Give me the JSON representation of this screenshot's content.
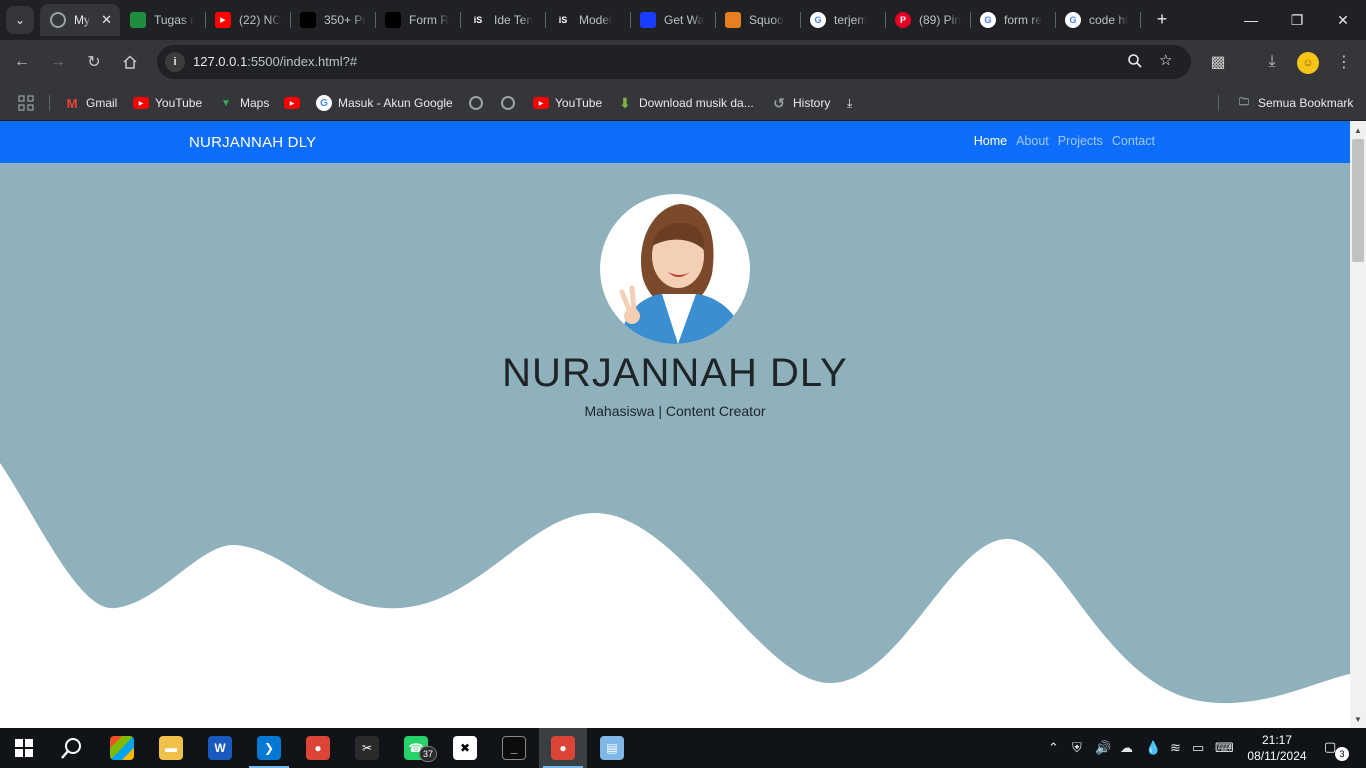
{
  "browser": {
    "tabs": [
      {
        "label": "My",
        "active": true,
        "icon": "globe-icon",
        "color": "#5f6368"
      },
      {
        "label": "Tugas r",
        "icon": "classroom-icon",
        "color": "#1e8e3e"
      },
      {
        "label": "(22) NC",
        "icon": "youtube-icon",
        "color": "#ff0000"
      },
      {
        "label": "350+ Pr",
        "icon": "site-icon",
        "color": "#000000"
      },
      {
        "label": "Form R",
        "icon": "site-icon",
        "color": "#000000"
      },
      {
        "label": "Ide Ten",
        "icon": "is-icon",
        "color": "#000000"
      },
      {
        "label": "Model",
        "icon": "is-icon",
        "color": "#000000"
      },
      {
        "label": "Get Wa",
        "icon": "getwa-icon",
        "color": "#1a3cff"
      },
      {
        "label": "Squoo",
        "icon": "squoosh-icon",
        "color": "#e67e22"
      },
      {
        "label": "terjem",
        "icon": "google-icon",
        "color": "#ffffff"
      },
      {
        "label": "(89) Pin",
        "icon": "pinterest-icon",
        "color": "#e60023"
      },
      {
        "label": "form re",
        "icon": "google-icon",
        "color": "#ffffff"
      },
      {
        "label": "code ht",
        "icon": "google-icon",
        "color": "#ffffff"
      }
    ],
    "url_host": "127.0.0.1",
    "url_rest": ":5500/index.html?#",
    "bookmarks": [
      {
        "label": "Gmail",
        "icon": "gmail-icon",
        "color": "#ea4335"
      },
      {
        "label": "YouTube",
        "icon": "youtube-icon",
        "color": "#ff0000"
      },
      {
        "label": "Maps",
        "icon": "maps-icon",
        "color": "#34a853"
      },
      {
        "label": "",
        "icon": "youtube-icon",
        "color": "#ff0000"
      },
      {
        "label": "Masuk - Akun Google",
        "icon": "google-icon",
        "color": "#ffffff"
      },
      {
        "label": "",
        "icon": "globe-icon",
        "color": "#9aa0a6"
      },
      {
        "label": "",
        "icon": "globe-icon",
        "color": "#9aa0a6"
      },
      {
        "label": "YouTube",
        "icon": "youtube-icon",
        "color": "#ff0000"
      },
      {
        "label": "Download musik da...",
        "icon": "download-arrow-icon",
        "color": "#7cb342"
      },
      {
        "label": "History",
        "icon": "history-icon",
        "color": "#9aa0a6"
      }
    ],
    "all_bookmarks": "Semua Bookmark"
  },
  "page": {
    "brand": "NURJANNAH DLY",
    "nav": [
      {
        "label": "Home",
        "active": true
      },
      {
        "label": "About",
        "active": false
      },
      {
        "label": "Projects",
        "active": false
      },
      {
        "label": "Contact",
        "active": false
      }
    ],
    "hero_title": "NURJANNAH DLY",
    "hero_subtitle": "Mahasiswa | Content Creator",
    "hero_color": "#8fb1bb",
    "navbar_color": "#0d6efd"
  },
  "taskbar": {
    "apps": [
      {
        "name": "file-explorer-icon",
        "running": false
      },
      {
        "name": "word-icon",
        "running": false
      },
      {
        "name": "vscode-icon",
        "running": true
      },
      {
        "name": "chrome-icon",
        "running": false
      },
      {
        "name": "snipping-icon",
        "running": false
      },
      {
        "name": "whatsapp-icon",
        "running": false,
        "badge": "37"
      },
      {
        "name": "capcut-icon",
        "running": false
      },
      {
        "name": "terminal-icon",
        "running": false
      },
      {
        "name": "chrome-profile-icon",
        "running": true,
        "active": true
      },
      {
        "name": "notepad-icon",
        "running": false
      }
    ],
    "time": "21:17",
    "date": "08/11/2024",
    "notifications": "3"
  }
}
